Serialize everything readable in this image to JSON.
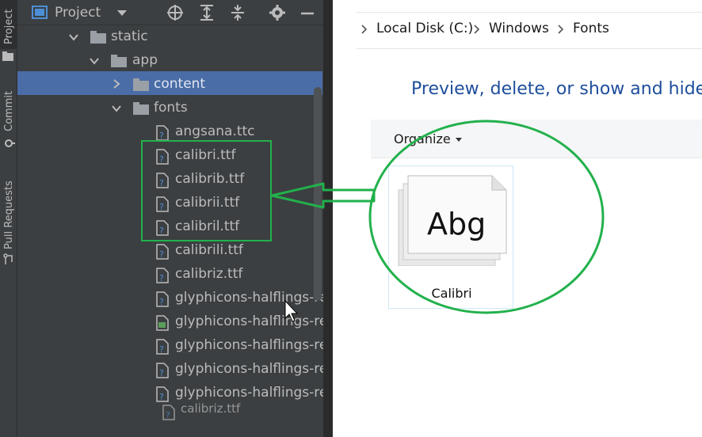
{
  "side_tabs": {
    "project": "Project",
    "commit": "Commit",
    "pull_requests": "Pull Requests"
  },
  "toolbar": {
    "title": "Project",
    "icons": [
      "project-view-icon",
      "dropdown-caret-icon",
      "locate-icon",
      "expand-all-icon",
      "collapse-all-icon",
      "settings-gear-icon",
      "minimize-icon"
    ]
  },
  "tree": {
    "static": "static",
    "app": "app",
    "content": "content",
    "fonts": "fonts",
    "files": [
      "angsana.ttc",
      "calibri.ttf",
      "calibrib.ttf",
      "calibrii.ttf",
      "calibril.ttf",
      "calibrili.ttf",
      "calibriz.ttf",
      "glyphicons-halflings-regu",
      "glyphicons-halflings-reg",
      "glyphicons-halflings-reg",
      "glyphicons-halflings-reg",
      "glyphicons-halflings-reg"
    ],
    "drag_ghost": "calibriz.ttf"
  },
  "explorer": {
    "breadcrumb": [
      "Local Disk (C:)",
      "Windows",
      "Fonts"
    ],
    "heading": "Preview, delete, or show and hide",
    "organize": "Organize",
    "font_tile_label": "Calibri",
    "font_sample": "Abg"
  },
  "colors": {
    "ide_bg": "#3c3f41",
    "selection": "#4a6da7",
    "highlight_green": "#22b14c",
    "explorer_heading": "#1e4e9b"
  }
}
